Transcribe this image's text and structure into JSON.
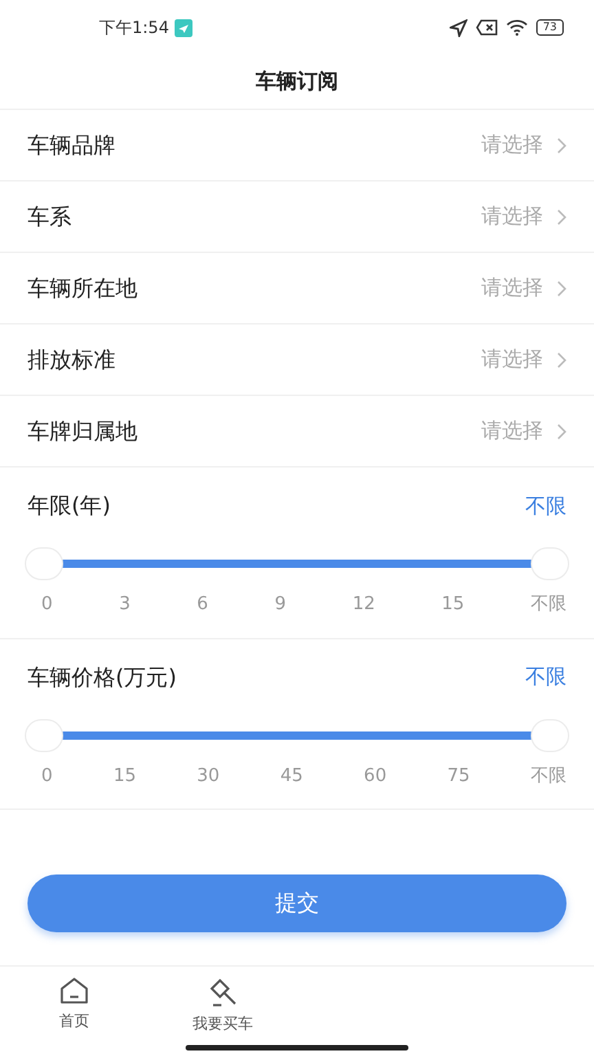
{
  "status_bar": {
    "time": "下午1:54",
    "battery": "73"
  },
  "header": {
    "title": "车辆订阅"
  },
  "select_rows": [
    {
      "label": "车辆品牌",
      "placeholder": "请选择"
    },
    {
      "label": "车系",
      "placeholder": "请选择"
    },
    {
      "label": "车辆所在地",
      "placeholder": "请选择"
    },
    {
      "label": "排放标准",
      "placeholder": "请选择"
    },
    {
      "label": "车牌归属地",
      "placeholder": "请选择"
    }
  ],
  "range_sliders": [
    {
      "label": "年限(年)",
      "value": "不限",
      "thumbs": [
        {
          "level": 0
        },
        {
          "level": 1
        }
      ],
      "ticks": [
        "0",
        "3",
        "6",
        "9",
        "12",
        "15",
        "不限"
      ]
    },
    {
      "label": "车辆价格(万元)",
      "value": "不限",
      "thumbs": [
        {
          "level": 0
        },
        {
          "level": 1
        }
      ],
      "ticks": [
        "0",
        "15",
        "30",
        "45",
        "60",
        "75",
        "不限"
      ]
    }
  ],
  "submit_button": "提交",
  "tab_bar": [
    {
      "kind": "home",
      "label": "首页"
    },
    {
      "kind": "buy",
      "label": "我要买车"
    }
  ]
}
